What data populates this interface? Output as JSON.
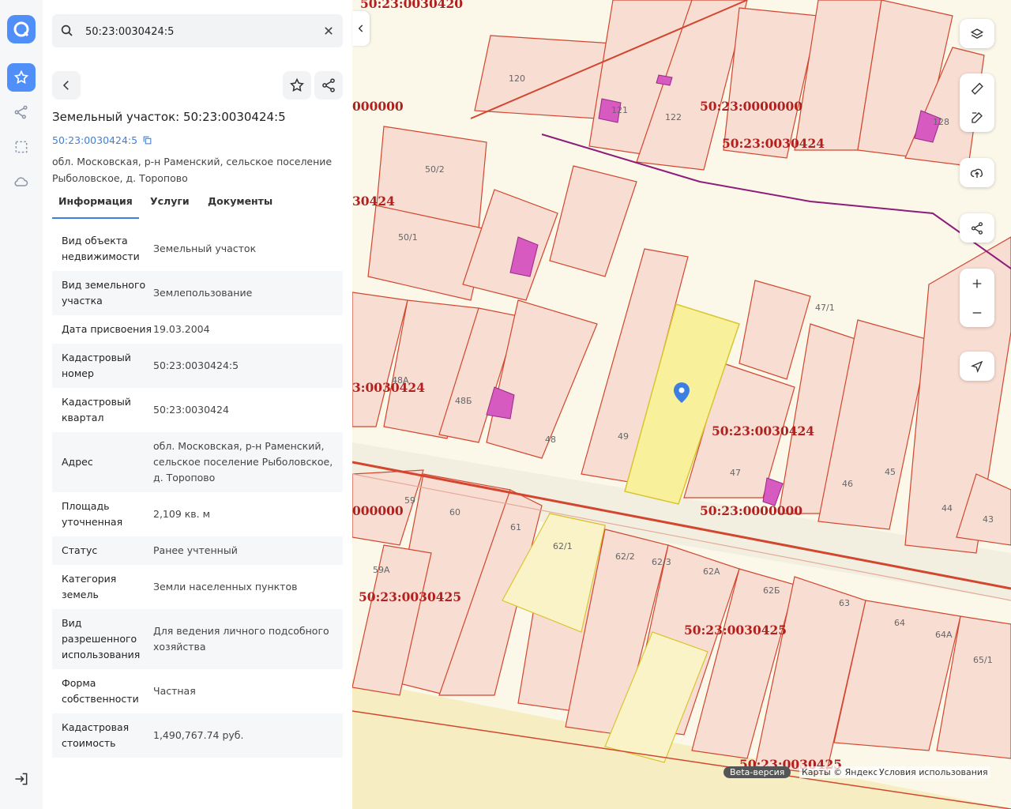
{
  "search": {
    "value": "50:23:0030424:5"
  },
  "object": {
    "title": "Земельный участок: 50:23:0030424:5",
    "cad_link": "50:23:0030424:5",
    "address_line": "обл. Московская, р-н Раменский, сельское поселение Рыболовское, д. Торопово"
  },
  "tabs": [
    "Информация",
    "Услуги",
    "Документы"
  ],
  "rows": [
    {
      "k": "Вид объекта недвижимости",
      "v": "Земельный участок"
    },
    {
      "k": "Вид земельного участка",
      "v": "Землепользование"
    },
    {
      "k": "Дата присвоения",
      "v": "19.03.2004"
    },
    {
      "k": "Кадастровый номер",
      "v": "50:23:0030424:5"
    },
    {
      "k": "Кадастровый квартал",
      "v": "50:23:0030424"
    },
    {
      "k": "Адрес",
      "v": "обл. Московская, р-н Раменский, сельское поселение Рыболовское, д. Торопово"
    },
    {
      "k": "Площадь уточненная",
      "v": "2,109 кв. м"
    },
    {
      "k": "Статус",
      "v": "Ранее учтенный"
    },
    {
      "k": "Категория земель",
      "v": "Земли населенных пунктов"
    },
    {
      "k": "Вид разрешенного использования",
      "v": "Для ведения личного подсобного хозяйства"
    },
    {
      "k": "Форма собственности",
      "v": "Частная"
    },
    {
      "k": "Кадастровая стоимость",
      "v": "1,490,767.74 руб."
    }
  ],
  "map": {
    "quarter_labels": [
      "50:23:0030420",
      "000000",
      "50:23:0000000",
      "50:23:0030424",
      "30424",
      "3:0030424",
      "50:23:0030424",
      "50:23:0000000",
      "000000",
      "50:23:0030425",
      "50:23:0030425",
      "50:23:0030425"
    ],
    "plot_labels": [
      "120",
      "121",
      "122",
      "128",
      "50/2",
      "50/1",
      "48А",
      "47/1",
      "48Б",
      "48",
      "49",
      "47",
      "46",
      "45",
      "44",
      "43",
      "59",
      "60",
      "61",
      "62/1",
      "62/2",
      "62/3",
      "62А",
      "62Б",
      "63",
      "64",
      "64А",
      "65/1",
      "59А"
    ],
    "beta_label": "Beta-версия",
    "attribution": "Карты © Яндекс",
    "terms": "Условия использования"
  },
  "colors": {
    "accent": "#4f8ff7",
    "link": "#3d7fe0",
    "boundary": "#d2462f",
    "selected_fill": "#f8f09b",
    "quarter_text": "#b0201e"
  },
  "icons": [
    "logo-icon",
    "star-icon",
    "route-icon",
    "selection-icon",
    "cloud-icon",
    "logout-icon",
    "search-icon",
    "close-icon",
    "back-icon",
    "share-icon",
    "copy-icon",
    "layers-icon",
    "ruler-icon",
    "edit-icon",
    "upload-icon",
    "plus-icon",
    "minus-icon",
    "locate-icon",
    "map-pin-icon"
  ]
}
